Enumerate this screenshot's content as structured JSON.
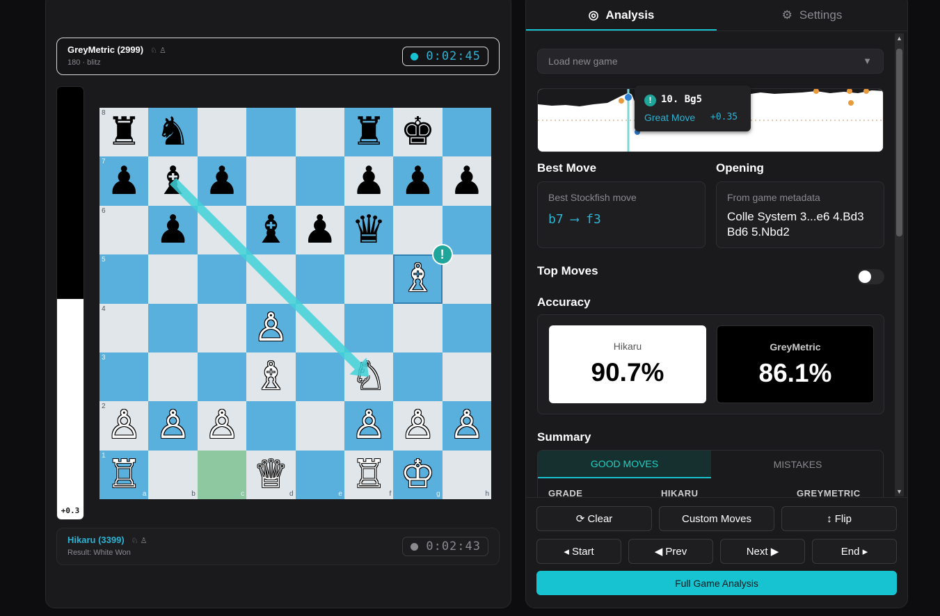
{
  "top_player": {
    "name": "GreyMetric (2999)",
    "meta": "180 · blitz",
    "icons": "♘ ♙",
    "clock": "0:02:45"
  },
  "bottom_player": {
    "name": "Hikaru (3399)",
    "meta": "Result: White Won",
    "icons": "♘ ♙",
    "clock": "0:02:43"
  },
  "eval_bar": {
    "label": "+0.3",
    "white_fraction": 0.51
  },
  "board": {
    "ranks": [
      "8",
      "7",
      "6",
      "5",
      "4",
      "3",
      "2",
      "1"
    ],
    "files": [
      "a",
      "b",
      "c",
      "d",
      "e",
      "f",
      "g",
      "h"
    ],
    "pieces": [
      {
        "sq": "a8",
        "p": "♜",
        "c": "b"
      },
      {
        "sq": "b8",
        "p": "♞",
        "c": "b"
      },
      {
        "sq": "f8",
        "p": "♜",
        "c": "b"
      },
      {
        "sq": "g8",
        "p": "♚",
        "c": "b"
      },
      {
        "sq": "a7",
        "p": "♟",
        "c": "b"
      },
      {
        "sq": "b7",
        "p": "♝",
        "c": "b"
      },
      {
        "sq": "c7",
        "p": "♟",
        "c": "b"
      },
      {
        "sq": "f7",
        "p": "♟",
        "c": "b"
      },
      {
        "sq": "g7",
        "p": "♟",
        "c": "b"
      },
      {
        "sq": "h7",
        "p": "♟",
        "c": "b"
      },
      {
        "sq": "b6",
        "p": "♟",
        "c": "b"
      },
      {
        "sq": "d6",
        "p": "♝",
        "c": "b"
      },
      {
        "sq": "e6",
        "p": "♟",
        "c": "b"
      },
      {
        "sq": "f6",
        "p": "♛",
        "c": "b"
      },
      {
        "sq": "g5",
        "p": "♗",
        "c": "w"
      },
      {
        "sq": "d4",
        "p": "♙",
        "c": "w"
      },
      {
        "sq": "d3",
        "p": "♗",
        "c": "w"
      },
      {
        "sq": "f3",
        "p": "♘",
        "c": "w"
      },
      {
        "sq": "a2",
        "p": "♙",
        "c": "w"
      },
      {
        "sq": "b2",
        "p": "♙",
        "c": "w"
      },
      {
        "sq": "c2",
        "p": "♙",
        "c": "w"
      },
      {
        "sq": "f2",
        "p": "♙",
        "c": "w"
      },
      {
        "sq": "g2",
        "p": "♙",
        "c": "w"
      },
      {
        "sq": "h2",
        "p": "♙",
        "c": "w"
      },
      {
        "sq": "a1",
        "p": "♖",
        "c": "w"
      },
      {
        "sq": "d1",
        "p": "♕",
        "c": "w"
      },
      {
        "sq": "f1",
        "p": "♖",
        "c": "w"
      },
      {
        "sq": "g1",
        "p": "♔",
        "c": "w"
      }
    ],
    "last_move_from": "c1",
    "last_move_to": "g5",
    "badge_square": "g5",
    "badge_symbol": "!",
    "arrow": {
      "from": "b7",
      "to": "f3"
    },
    "colors": {
      "light": "#e0e6ea",
      "dark": "#5ab0dd",
      "arrow": "#3fd0d8",
      "badge": "#20a59b"
    }
  },
  "tabs": {
    "analysis": "Analysis",
    "settings": "Settings"
  },
  "load_game": {
    "placeholder": "Load new game",
    "caret": "▼"
  },
  "tooltip": {
    "symbol": "!",
    "move": "10. Bg5",
    "label": "Great Move",
    "eval": "+0.35"
  },
  "best_move": {
    "title": "Best Move",
    "caption": "Best Stockfish move",
    "value": "b7 ⟶ f3"
  },
  "opening": {
    "title": "Opening",
    "caption": "From game metadata",
    "value": "Colle System 3...e6 4.Bd3 Bd6 5.Nbd2"
  },
  "top_moves": {
    "title": "Top Moves",
    "enabled": false
  },
  "accuracy": {
    "title": "Accuracy",
    "white_name": "Hikaru",
    "white_value": "90.7%",
    "black_name": "GreyMetric",
    "black_value": "86.1%"
  },
  "summary": {
    "title": "Summary",
    "tab_good": "GOOD MOVES",
    "tab_mistakes": "MISTAKES",
    "col_grade": "GRADE",
    "col_white": "HIKARU",
    "col_black": "GREYMETRIC"
  },
  "buttons": {
    "clear": "⟳ Clear",
    "custom": "Custom Moves",
    "flip": "↕ Flip",
    "start": "◂ Start",
    "prev": "◀ Prev",
    "next": "Next ▶",
    "end": "End ▸",
    "full": "Full Game Analysis"
  },
  "accent": "#17c3d0"
}
